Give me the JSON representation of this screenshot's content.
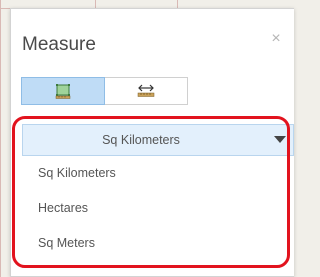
{
  "widget": {
    "title": "Measure",
    "close_glyph": "×"
  },
  "tools": [
    {
      "name": "area-tool",
      "icon": "area-measure-icon",
      "active": true
    },
    {
      "name": "distance-tool",
      "icon": "distance-measure-icon",
      "active": false
    }
  ],
  "unit_dropdown": {
    "selected": "Sq Kilometers",
    "options": [
      "Sq Kilometers",
      "Hectares",
      "Sq Meters"
    ]
  },
  "colors": {
    "active_tool_bg": "#bfdcf6",
    "dropdown_bg": "#e3f0fc",
    "annotation_red": "#e2131e"
  }
}
